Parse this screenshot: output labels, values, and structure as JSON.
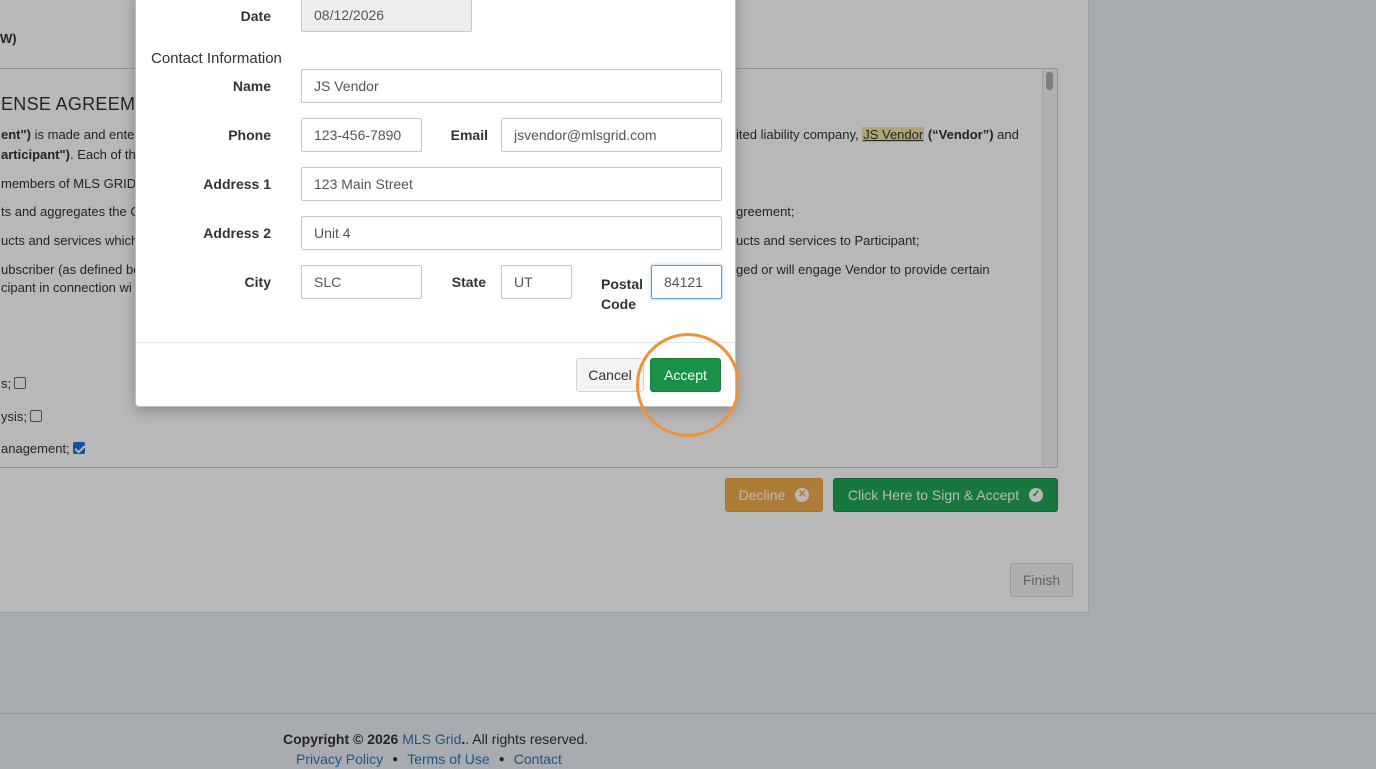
{
  "background": {
    "heading_fragment": "W)",
    "agreement_title": "ENSE AGREEME",
    "lines": [
      {
        "pre_bold": "ent\")",
        "text": " is made and enter"
      },
      {
        "pre_bold": "articipant\")",
        "text": ". Each of th"
      },
      {
        "text": " members of MLS GRID"
      },
      {
        "text": "ts and aggregates the C"
      },
      {
        "text": "ucts and services which"
      },
      {
        "text": "ubscriber (as defined be"
      },
      {
        "text": "cipant in connection wi"
      }
    ],
    "right_lines": {
      "line1_pre": "ited liability company, ",
      "vendor_name": "JS Vendor",
      "line1_bold": " (“Vendor”)",
      "line1_post": " and",
      "line2": "greement;",
      "line3": "ucts and services to Participant;",
      "line4": "ged or will engage Vendor to provide certain"
    },
    "checkbox_rows": [
      {
        "label": "s;",
        "checked": false
      },
      {
        "label": "ysis;",
        "checked": false
      },
      {
        "label": "anagement;",
        "checked": true
      }
    ],
    "decline_button": "Decline",
    "sign_accept_button": "Click Here to Sign & Accept",
    "finish_button": "Finish"
  },
  "footer": {
    "copyright_prefix": "Copyright © 2026 ",
    "brand": "MLS Grid",
    "copyright_suffix": ". All rights reserved.",
    "links": [
      "Privacy Policy",
      "Terms of Use",
      "Contact"
    ]
  },
  "modal": {
    "date_label": "Date",
    "date_value": "08/12/2026",
    "section_title": "Contact Information",
    "name_label": "Name",
    "name_value": "JS Vendor",
    "phone_label": "Phone",
    "phone_value": "123-456-7890",
    "email_label": "Email",
    "email_value": "jsvendor@mlsgrid.com",
    "address1_label": "Address 1",
    "address1_value": "123 Main Street",
    "address2_label": "Address 2",
    "address2_value": "Unit 4",
    "city_label": "City",
    "city_value": "SLC",
    "state_label": "State",
    "state_value": "UT",
    "postal_label_line1": "Postal",
    "postal_label_line2": "Code",
    "postal_value": "84121",
    "cancel_button": "Cancel",
    "accept_button": "Accept"
  },
  "colors": {
    "accept_green": "#1a9148",
    "sign_green": "#22a45a",
    "decline_orange": "#f0ad4e",
    "highlight_ring": "#f0923a",
    "link_blue": "#2a7ab8"
  },
  "icons": {
    "decline": "times-circle-icon",
    "sign_accept": "check-circle-icon"
  }
}
